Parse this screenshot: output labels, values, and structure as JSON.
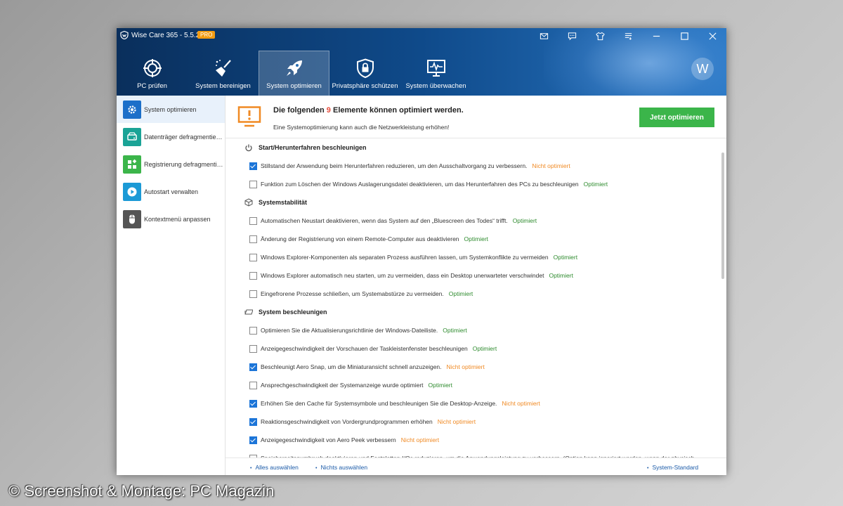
{
  "window": {
    "title": "Wise Care 365 - 5.5.2",
    "badge": "PRO"
  },
  "titlebar_icons": [
    "mail-icon",
    "feedback-icon",
    "skin-icon",
    "menu-icon",
    "minimize-icon",
    "maximize-icon",
    "close-icon"
  ],
  "nav": {
    "tabs": [
      {
        "label": "PC prüfen",
        "icon": "target-icon"
      },
      {
        "label": "System bereinigen",
        "icon": "broom-icon"
      },
      {
        "label": "System optimieren",
        "icon": "rocket-icon"
      },
      {
        "label": "Privatsphäre schützen",
        "icon": "shield-lock-icon"
      },
      {
        "label": "System überwachen",
        "icon": "monitor-pulse-icon"
      }
    ],
    "active_index": 2,
    "avatar_letter": "W"
  },
  "sidebar": {
    "items": [
      {
        "label": "System optimieren",
        "icon": "gear-icon",
        "color": "#1c6fc9"
      },
      {
        "label": "Datenträger defragmentie…",
        "icon": "disk-icon",
        "color": "#1aa396"
      },
      {
        "label": "Registrierung defragmenti…",
        "icon": "registry-icon",
        "color": "#3bb54a"
      },
      {
        "label": "Autostart verwalten",
        "icon": "play-icon",
        "color": "#1c9ad6"
      },
      {
        "label": "Kontextmenü anpassen",
        "icon": "mouse-icon",
        "color": "#555555"
      }
    ],
    "active_index": 0
  },
  "banner": {
    "title_prefix": "Die folgenden",
    "count": "9",
    "title_suffix": "Elemente können optimiert werden.",
    "subtitle": "Eine Systemoptimierung kann auch die Netzwerkleistung erhöhen!",
    "button": "Jetzt optimieren"
  },
  "sections": [
    {
      "title": "Start/Herunterfahren beschleunigen",
      "icon": "power-icon",
      "items": [
        {
          "text": "Stillstand der Anwendung beim Herunterfahren reduzieren, um den Ausschaltvorgang zu verbessern.",
          "checked": true,
          "status": "Nicht optimiert"
        },
        {
          "text": "Funktion zum Löschen der Windows Auslagerungsdatei deaktivieren, um das Herunterfahren des PCs zu beschleunigen",
          "checked": false,
          "status": "Optimiert"
        }
      ]
    },
    {
      "title": "Systemstabilität",
      "icon": "cube-icon",
      "items": [
        {
          "text": "Automatischen Neustart deaktivieren, wenn das System auf den „Bluescreen des Todes“ trifft.",
          "checked": false,
          "status": "Optimiert"
        },
        {
          "text": "Änderung der Registrierung von einem Remote-Computer aus deaktivieren",
          "checked": false,
          "status": "Optimiert"
        },
        {
          "text": "Windows Explorer-Komponenten als separaten Prozess ausführen lassen, um Systemkonflikte zu vermeiden",
          "checked": false,
          "status": "Optimiert"
        },
        {
          "text": "Windows Explorer automatisch neu starten, um zu vermeiden, dass ein Desktop unerwarteter verschwindet",
          "checked": false,
          "status": "Optimiert"
        },
        {
          "text": "Eingefrorene Prozesse schließen, um Systemabstürze zu vermeiden.",
          "checked": false,
          "status": "Optimiert"
        }
      ]
    },
    {
      "title": "System beschleunigen",
      "icon": "speed-icon",
      "items": [
        {
          "text": "Optimieren Sie die Aktualisierungsrichtlinie der Windows-Dateiliste.",
          "checked": false,
          "status": "Optimiert"
        },
        {
          "text": "Anzeigegeschwindigkeit der Vorschauen der Taskleistenfenster beschleunigen",
          "checked": false,
          "status": "Optimiert"
        },
        {
          "text": "Beschleunigt Aero Snap, um die Miniaturansicht schnell anzuzeigen.",
          "checked": true,
          "status": "Nicht optimiert"
        },
        {
          "text": "Ansprechgeschwindigkeit der Systemanzeige wurde optimiert",
          "checked": false,
          "status": "Optimiert"
        },
        {
          "text": "Erhöhen Sie den Cache für Systemsymbole und beschleunigen Sie die Desktop-Anzeige.",
          "checked": true,
          "status": "Nicht optimiert"
        },
        {
          "text": "Reaktionsgeschwindigkeit von Vordergrundprogrammen erhöhen",
          "checked": true,
          "status": "Nicht optimiert"
        },
        {
          "text": "Anzeigegeschwindigkeit von Aero Peek verbessern",
          "checked": true,
          "status": "Nicht optimiert"
        },
        {
          "text": "Speicherseitenumbruch deaktivieren und Festplatten-I/Os reduzieren, um die Anwendungsleistung zu verbessern. (Option kann ignoriert werden, wenn der physisch",
          "checked": false,
          "status": ""
        }
      ]
    }
  ],
  "footer": {
    "select_all": "Alles auswählen",
    "select_none": "Nichts auswählen",
    "system_default": "System-Standard"
  },
  "watermark": "© Screenshot & Montage: PC Magazin"
}
